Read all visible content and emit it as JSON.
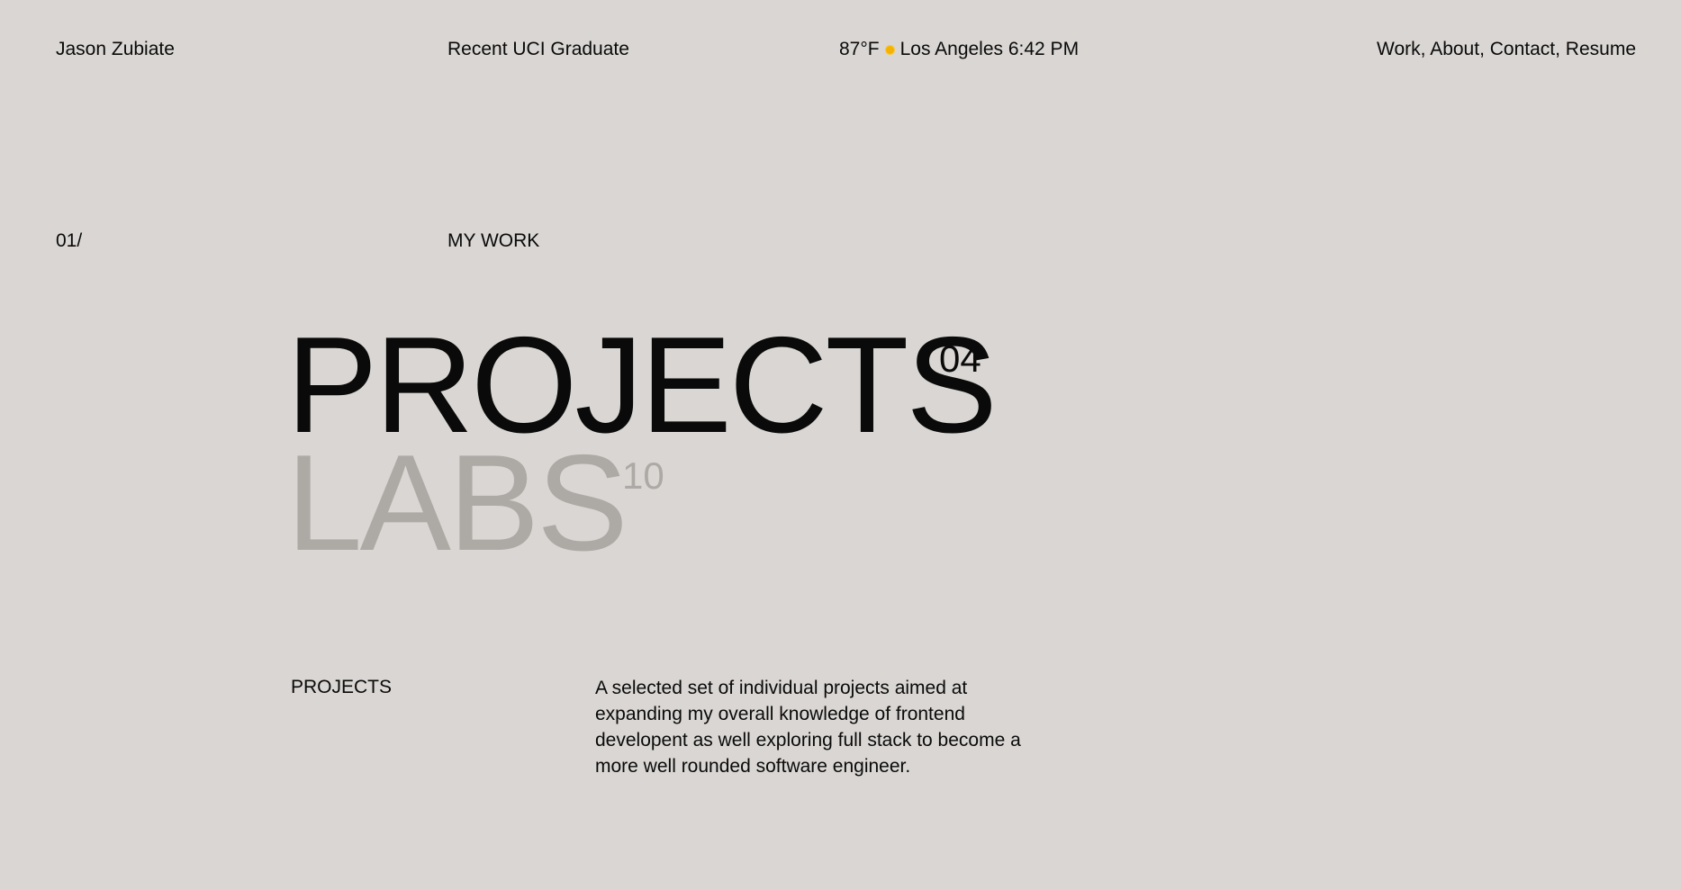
{
  "header": {
    "name": "Jason Zubiate",
    "tagline": "Recent UCI Graduate",
    "temperature": "87°F",
    "weather_icon": "sun-icon",
    "location_time": "Los Angeles 6:42 PM",
    "nav": {
      "work": "Work",
      "about": "About",
      "contact": "Contact",
      "resume": "Resume",
      "separator": ", "
    }
  },
  "section": {
    "number": "01/",
    "title": "MY WORK"
  },
  "categories": {
    "projects": {
      "label": "PROJECTS",
      "count": "04"
    },
    "labs": {
      "label": "LABS",
      "count": "10"
    }
  },
  "detail": {
    "label": "PROJECTS",
    "description": "A selected set of individual projects aimed at expanding my overall knowledge of frontend developent as well exploring full stack to become a more well rounded software engineer."
  },
  "colors": {
    "background": "#d9d6d3",
    "text": "#0a0a0a",
    "muted": "#adaaa6",
    "sun": "#f5b301"
  }
}
